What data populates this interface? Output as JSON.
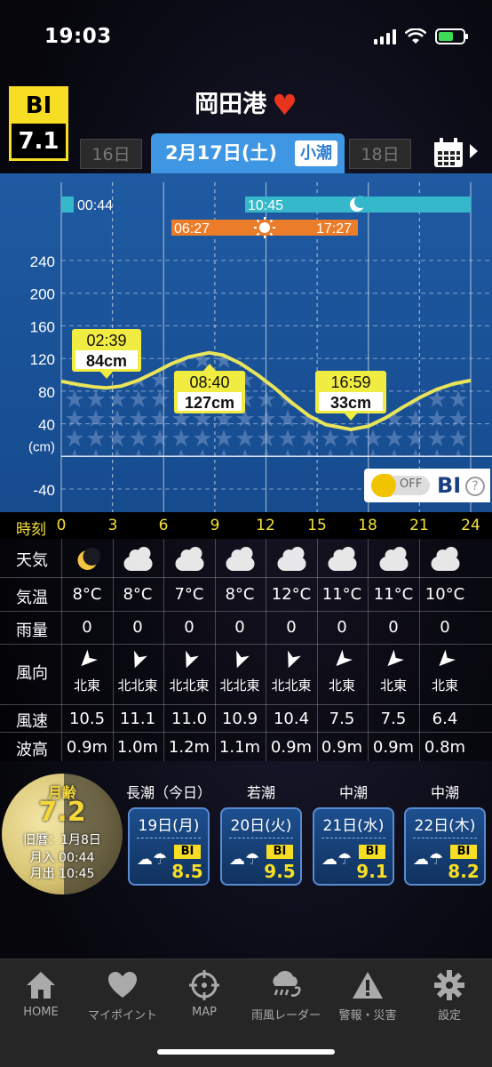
{
  "status": {
    "time": "19:03"
  },
  "bi_badge": {
    "label": "BI",
    "value": "7.1"
  },
  "place": {
    "name": "岡田港"
  },
  "date_nav": {
    "prev": "16日",
    "current": "2月17日(土)",
    "tide_type": "小潮",
    "next": "18日"
  },
  "chart": {
    "moonset": "00:44",
    "moonrise": "10:45",
    "sunrise": "06:27",
    "sunset": "17:27",
    "unit": "(cm)",
    "y_ticks": [
      "240",
      "200",
      "160",
      "120",
      "80",
      "40",
      "-40"
    ],
    "bi_toggle": {
      "state": "OFF",
      "label": "BI",
      "help": "?"
    }
  },
  "chart_data": {
    "type": "line",
    "title": "",
    "xlabel": "時刻",
    "ylabel": "(cm)",
    "xlim": [
      0,
      24
    ],
    "ylim": [
      -60,
      270
    ],
    "x_ticks": [
      0,
      3,
      6,
      9,
      12,
      15,
      18,
      21,
      24
    ],
    "y_ticks": [
      240,
      200,
      160,
      120,
      80,
      40,
      0,
      -40
    ],
    "extremes": [
      {
        "time": "02:39",
        "height": "84cm"
      },
      {
        "time": "08:40",
        "height": "127cm"
      },
      {
        "time": "16:59",
        "height": "33cm"
      }
    ],
    "series": [
      {
        "x": [
          0,
          1,
          2,
          2.65,
          3.5,
          4.5,
          5.5,
          6.5,
          7.5,
          8.67,
          9.5,
          10.5,
          11.5,
          12.5,
          13.5,
          14.5,
          15.5,
          16.98,
          18,
          19,
          20,
          21,
          22,
          23,
          24
        ],
        "values": [
          92,
          88,
          85,
          84,
          86,
          93,
          103,
          114,
          122,
          127,
          124,
          114,
          100,
          84,
          66,
          50,
          39,
          33,
          37,
          47,
          60,
          72,
          82,
          89,
          93
        ]
      }
    ]
  },
  "hours_row": {
    "label": "時刻",
    "hours": [
      "0",
      "3",
      "6",
      "9",
      "12",
      "15",
      "18",
      "21",
      "24"
    ]
  },
  "forecast": {
    "labels": {
      "weather": "天気",
      "temp": "気温",
      "rain": "雨量",
      "wind_dir": "風向",
      "wind_speed": "風速",
      "wave": "波高"
    },
    "columns": [
      {
        "weather_icon": "moon-icon",
        "temp": "8°C",
        "rain": "0",
        "wind_dir": "北東",
        "wind_speed": "10.5",
        "wave": "0.9m"
      },
      {
        "weather_icon": "cloud-icon",
        "temp": "8°C",
        "rain": "0",
        "wind_dir": "北北東",
        "wind_speed": "11.1",
        "wave": "1.0m"
      },
      {
        "weather_icon": "cloud-icon",
        "temp": "7°C",
        "rain": "0",
        "wind_dir": "北北東",
        "wind_speed": "11.0",
        "wave": "1.2m"
      },
      {
        "weather_icon": "cloud-icon",
        "temp": "8°C",
        "rain": "0",
        "wind_dir": "北北東",
        "wind_speed": "10.9",
        "wave": "1.1m"
      },
      {
        "weather_icon": "cloud-icon",
        "temp": "12°C",
        "rain": "0",
        "wind_dir": "北北東",
        "wind_speed": "10.4",
        "wave": "0.9m"
      },
      {
        "weather_icon": "cloud-icon",
        "temp": "11°C",
        "rain": "0",
        "wind_dir": "北東",
        "wind_speed": "7.5",
        "wave": "0.9m"
      },
      {
        "weather_icon": "cloud-icon",
        "temp": "11°C",
        "rain": "0",
        "wind_dir": "北東",
        "wind_speed": "7.5",
        "wave": "0.9m"
      },
      {
        "weather_icon": "cloud-icon",
        "temp": "10°C",
        "rain": "0",
        "wind_dir": "北東",
        "wind_speed": "6.4",
        "wave": "0.8m"
      }
    ]
  },
  "moon": {
    "age_label": "月齢",
    "age": "7.2",
    "lunar_date": "旧暦：1月8日",
    "moonrise": "月入 00:44",
    "moonset": "月出 10:45"
  },
  "upcoming": [
    {
      "tide": "長潮（今日）",
      "date": "19日(月)",
      "bi_label": "BI",
      "bi": "8.5"
    },
    {
      "tide": "若潮",
      "date": "20日(火)",
      "bi_label": "BI",
      "bi": "9.5"
    },
    {
      "tide": "中潮",
      "date": "21日(水)",
      "bi_label": "BI",
      "bi": "9.1"
    },
    {
      "tide": "中潮",
      "date": "22日(木)",
      "bi_label": "BI",
      "bi": "8.2"
    }
  ],
  "tabs": [
    {
      "label": "HOME",
      "icon": "home-icon"
    },
    {
      "label": "マイポイント",
      "icon": "heart-icon"
    },
    {
      "label": "MAP",
      "icon": "crosshair-icon"
    },
    {
      "label": "雨風レーダー",
      "icon": "rain-radar-icon"
    },
    {
      "label": "警報・災害",
      "icon": "warning-icon"
    },
    {
      "label": "設定",
      "icon": "gear-icon"
    }
  ]
}
